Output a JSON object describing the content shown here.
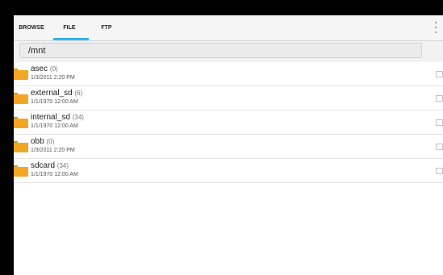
{
  "tabs": [
    {
      "label": "BROWSE"
    },
    {
      "label": "FILE"
    },
    {
      "label": "FTP"
    }
  ],
  "active_tab": "FILE",
  "path": "/mnt",
  "colors": {
    "accent": "#33b5e5",
    "folder": "#f3a624"
  },
  "icons": {
    "folder": "folder-icon",
    "menu": "overflow-menu-icon"
  },
  "files": [
    {
      "name": "asec",
      "count": "(0)",
      "date": "1/3/2011 2:20 PM"
    },
    {
      "name": "external_sd",
      "count": "(6)",
      "date": "1/1/1970 12:00 AM"
    },
    {
      "name": "internal_sd",
      "count": "(34)",
      "date": "1/1/1970 12:00 AM"
    },
    {
      "name": "obb",
      "count": "(0)",
      "date": "1/3/2011 2:20 PM"
    },
    {
      "name": "sdcard",
      "count": "(34)",
      "date": "1/1/1970 12:00 AM"
    }
  ]
}
